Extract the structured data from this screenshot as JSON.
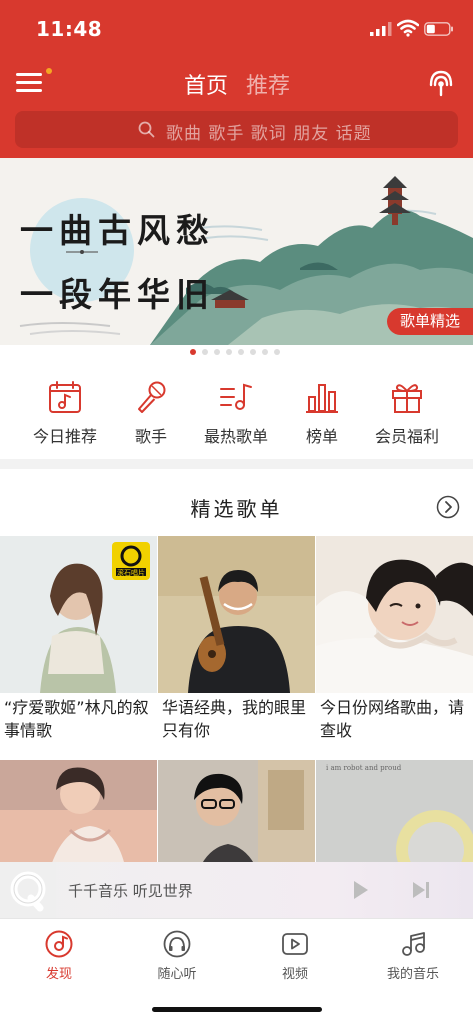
{
  "status_bar": {
    "time": "11:48"
  },
  "header": {
    "tabs": [
      {
        "label": "首页",
        "active": true
      },
      {
        "label": "推荐",
        "active": false
      }
    ],
    "menu_icon": "menu-icon",
    "radio_icon": "radio-icon",
    "accent_color": "#d8392e"
  },
  "search": {
    "placeholder": "歌曲 歌手 歌词 朋友 话题"
  },
  "banner": {
    "line1": "一曲古风愁",
    "line2": "一段年华旧",
    "badge": "歌单精选",
    "page_count": 8,
    "current_page": 1
  },
  "categories": [
    {
      "label": "今日推荐",
      "icon": "calendar-music-icon"
    },
    {
      "label": "歌手",
      "icon": "microphone-icon"
    },
    {
      "label": "最热歌单",
      "icon": "playlist-icon"
    },
    {
      "label": "榜单",
      "icon": "chart-icon"
    },
    {
      "label": "会员福利",
      "icon": "gift-icon"
    }
  ],
  "playlists": {
    "title": "精选歌单",
    "items": [
      {
        "title": "“疗爱歌姬”林凡的叙事情歌",
        "cover_badge": "滚石唱片"
      },
      {
        "title": "华语经典，我的眼里只有你"
      },
      {
        "title": "今日份网络歌曲，请查收"
      },
      {
        "title": ""
      },
      {
        "title": ""
      },
      {
        "title": "",
        "cover_text": "i am robot and proud"
      }
    ]
  },
  "player": {
    "text": "千千音乐 听见世界"
  },
  "tabbar": [
    {
      "label": "发现",
      "icon": "discover-icon",
      "active": true
    },
    {
      "label": "随心听",
      "icon": "headphones-icon",
      "active": false
    },
    {
      "label": "视频",
      "icon": "video-icon",
      "active": false
    },
    {
      "label": "我的音乐",
      "icon": "music-note-icon",
      "active": false
    }
  ]
}
